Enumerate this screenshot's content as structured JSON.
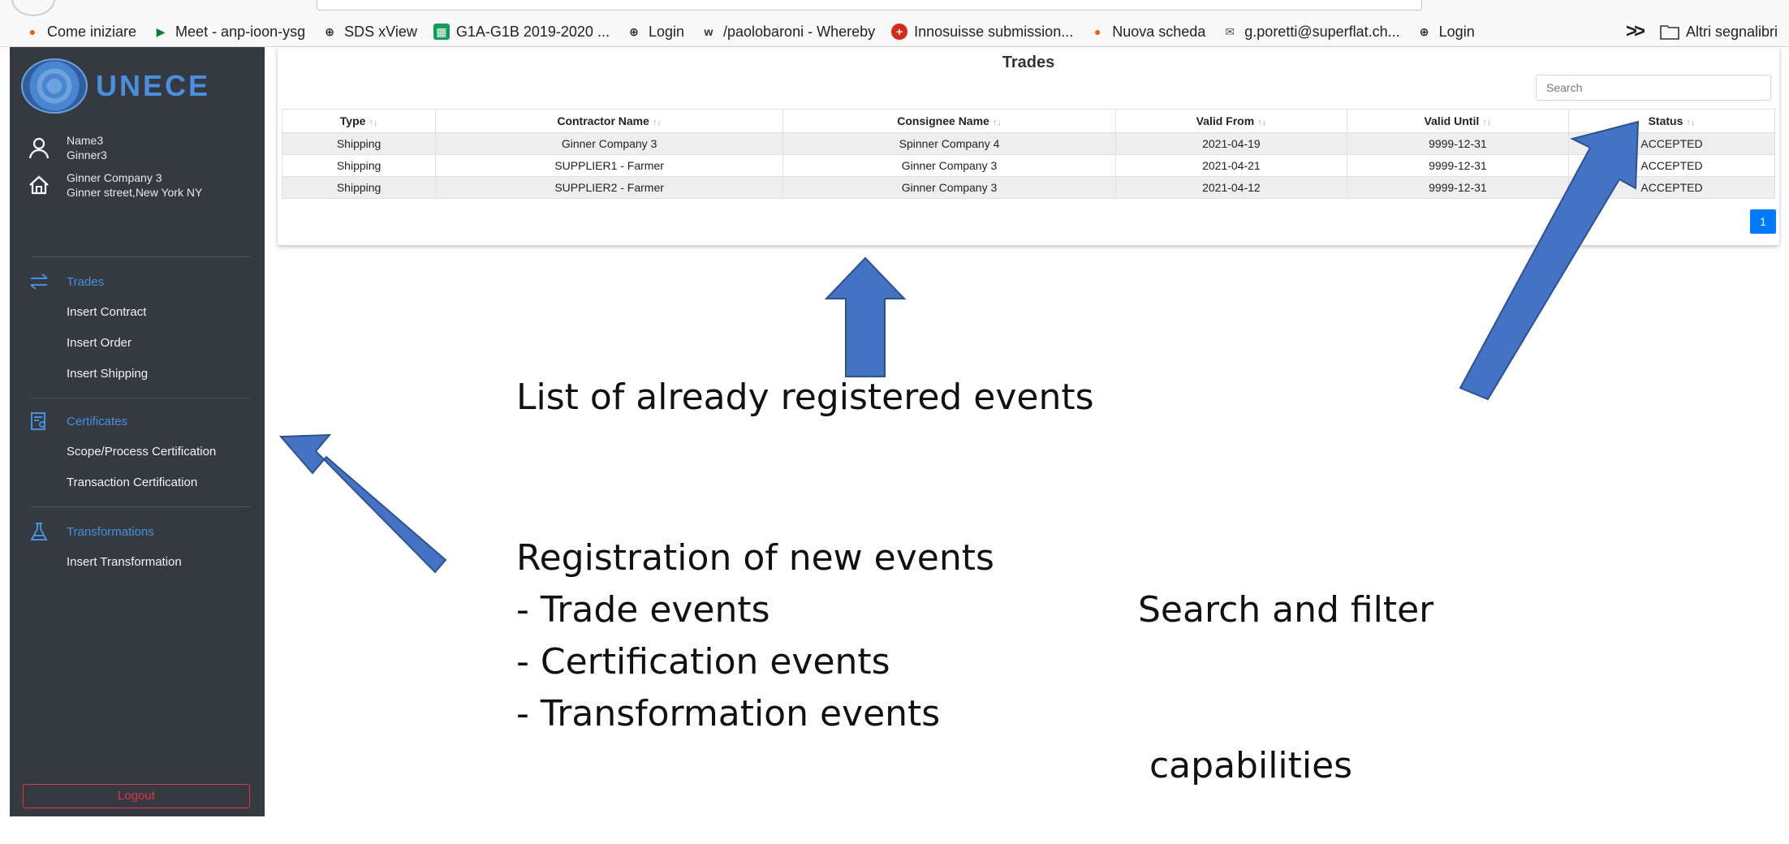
{
  "bookmarks": {
    "items": [
      {
        "label": "Come iniziare",
        "icon": "firefox-icon",
        "color": "#e66000"
      },
      {
        "label": "Meet - anp-ioon-ysg",
        "icon": "meet-icon",
        "color": "#00832d"
      },
      {
        "label": "SDS xView",
        "icon": "globe-icon",
        "color": "#222222"
      },
      {
        "label": "G1A-G1B 2019-2020 ...",
        "icon": "sheets-icon",
        "color": "#0f9d58"
      },
      {
        "label": "Login",
        "icon": "globe-icon",
        "color": "#222222"
      },
      {
        "label": "/paolobaroni - Whereby",
        "icon": "whereby-icon",
        "color": "#333333"
      },
      {
        "label": "Innosuisse submission...",
        "icon": "swiss-cross-icon",
        "color": "#d52b1e"
      },
      {
        "label": "Nuova scheda",
        "icon": "firefox-icon",
        "color": "#e66000"
      },
      {
        "label": "g.poretti@superflat.ch...",
        "icon": "mail-icon",
        "color": "#555555"
      },
      {
        "label": "Login",
        "icon": "globe-icon",
        "color": "#222222"
      }
    ],
    "overflow_label": "Altri segnalibri"
  },
  "sidebar": {
    "brand": "UNECE",
    "user_name": "Name3",
    "user_login": "Ginner3",
    "company_name": "Ginner Company 3",
    "company_address": "Ginner street,New York NY",
    "sections": [
      {
        "title": "Trades",
        "icon": "exchange-icon",
        "items": [
          "Insert Contract",
          "Insert Order",
          "Insert Shipping"
        ]
      },
      {
        "title": "Certificates",
        "icon": "certificate-icon",
        "items": [
          "Scope/Process Certification",
          "Transaction Certification"
        ]
      },
      {
        "title": "Transformations",
        "icon": "flask-icon",
        "items": [
          "Insert Transformation"
        ]
      }
    ],
    "logout_label": "Logout",
    "accent": "#4a8ee0"
  },
  "trades": {
    "title": "Trades",
    "search_placeholder": "Search",
    "columns": [
      "Type",
      "Contractor Name",
      "Consignee Name",
      "Valid From",
      "Valid Until",
      "Status"
    ],
    "sort_glyph": "↑↓",
    "rows": [
      [
        "Shipping",
        "Ginner Company 3",
        "Spinner Company 4",
        "2021-04-19",
        "9999-12-31",
        "ACCEPTED"
      ],
      [
        "Shipping",
        "SUPPLIER1 - Farmer",
        "Ginner Company 3",
        "2021-04-21",
        "9999-12-31",
        "ACCEPTED"
      ],
      [
        "Shipping",
        "SUPPLIER2 - Farmer",
        "Ginner Company 3",
        "2021-04-12",
        "9999-12-31",
        "ACCEPTED"
      ]
    ],
    "page": "1"
  },
  "annotations": {
    "list_label": "List of already registered events",
    "registration_lines": [
      "Registration of new events",
      "- Trade events",
      "- Certification events",
      "- Transformation events"
    ],
    "search_lines": [
      "Search and filter",
      " capabilities"
    ],
    "arrow_color": "#4472c4"
  }
}
